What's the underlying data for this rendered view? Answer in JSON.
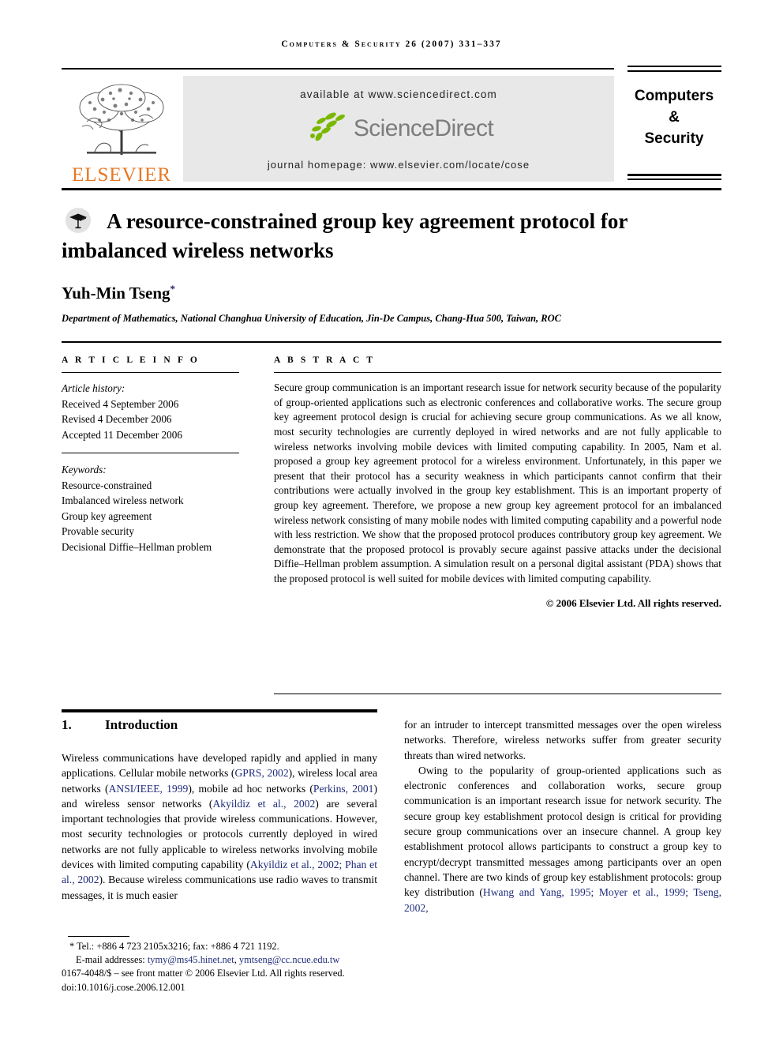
{
  "running_head": "Computers & Security 26 (2007) 331–337",
  "masthead": {
    "publisher_name": "ELSEVIER",
    "publisher_logo_icon": "elsevier-tree-logo",
    "available_at": "available at www.sciencedirect.com",
    "sciencedirect_wordmark": "ScienceDirect",
    "sciencedirect_logo_icon": "sciencedirect-leaves-logo",
    "journal_homepage": "journal homepage: www.elsevier.com/locate/cose",
    "journal_title_lines": [
      "Computers",
      "&",
      "Security"
    ]
  },
  "title_block": {
    "crossmark_icon": "graduation-cap-icon",
    "title": "A resource-constrained group key agreement protocol for imbalanced wireless networks",
    "author": "Yuh-Min Tseng",
    "author_marker": "*",
    "affiliation": "Department of Mathematics, National Changhua University of Education, Jin-De Campus, Chang-Hua 500, Taiwan, ROC"
  },
  "article_info": {
    "heading": "A R T I C L E   I N F O",
    "history_label": "Article history:",
    "history": [
      "Received 4 September 2006",
      "Revised 4 December 2006",
      "Accepted 11 December 2006"
    ],
    "keywords_label": "Keywords:",
    "keywords": [
      "Resource-constrained",
      "Imbalanced wireless network",
      "Group key agreement",
      "Provable security",
      "Decisional Diffie–Hellman problem"
    ]
  },
  "abstract": {
    "heading": "A B S T R A C T",
    "text": "Secure group communication is an important research issue for network security because of the popularity of group-oriented applications such as electronic conferences and collaborative works. The secure group key agreement protocol design is crucial for achieving secure group communications. As we all know, most security technologies are currently deployed in wired networks and are not fully applicable to wireless networks involving mobile devices with limited computing capability. In 2005, Nam et al. proposed a group key agreement protocol for a wireless environment. Unfortunately, in this paper we present that their protocol has a security weakness in which participants cannot confirm that their contributions were actually involved in the group key establishment. This is an important property of group key agreement. Therefore, we propose a new group key agreement protocol for an imbalanced wireless network consisting of many mobile nodes with limited computing capability and a powerful node with less restriction. We show that the proposed protocol produces contributory group key agreement. We demonstrate that the proposed protocol is provably secure against passive attacks under the decisional Diffie–Hellman problem assumption. A simulation result on a personal digital assistant (PDA) shows that the proposed protocol is well suited for mobile devices with limited computing capability.",
    "copyright": "© 2006 Elsevier Ltd. All rights reserved."
  },
  "body": {
    "section_number": "1.",
    "section_title": "Introduction",
    "left_column": {
      "para1_a": "Wireless communications have developed rapidly and applied in many applications. Cellular mobile networks (",
      "cite1": "GPRS, 2002",
      "para1_b": "), wireless local area networks (",
      "cite2": "ANSI/IEEE, 1999",
      "para1_c": "), mobile ad hoc networks (",
      "cite3": "Perkins, 2001",
      "para1_d": ") and wireless sensor networks (",
      "cite4": "Akyildiz et al., 2002",
      "para1_e": ") are several important technologies that provide wireless communications. However, most security technologies or protocols currently deployed in wired networks are not fully applicable to wireless networks involving mobile devices with limited computing capability (",
      "cite5": "Akyildiz et al., 2002; Phan et al., 2002",
      "para1_f": "). Because wireless communications use radio waves to transmit messages, it is much easier"
    },
    "right_column": {
      "para1": "for an intruder to intercept transmitted messages over the open wireless networks. Therefore, wireless networks suffer from greater security threats than wired networks.",
      "para2_a": "Owing to the popularity of group-oriented applications such as electronic conferences and collaboration works, secure group communication is an important research issue for network security. The secure group key establishment protocol design is critical for providing secure group communications over an insecure channel. A group key establishment protocol allows participants to construct a group key to encrypt/decrypt transmitted messages among participants over an open channel. There are two kinds of group key establishment protocols: group key distribution (",
      "cite1": "Hwang and Yang, 1995; Moyer et al., 1999; Tseng, 2002,"
    }
  },
  "footnotes": {
    "telephone": "* Tel.: +886 4 723 2105x3216; fax: +886 4 721 1192.",
    "email_label": "E-mail addresses:",
    "email1": "tymy@ms45.hinet.net",
    "email_sep": ", ",
    "email2": "ymtseng@cc.ncue.edu.tw",
    "issn_line": "0167-4048/$ – see front matter © 2006 Elsevier Ltd. All rights reserved.",
    "doi_line": "doi:10.1016/j.cose.2006.12.001"
  },
  "colors": {
    "elsevier_orange": "#E87722",
    "citation_blue": "#1F2C7A",
    "banner_gray": "#E8E8E8",
    "sciencedirect_gray": "#7C7C7C",
    "sciencedirect_green": "#7AB800"
  }
}
